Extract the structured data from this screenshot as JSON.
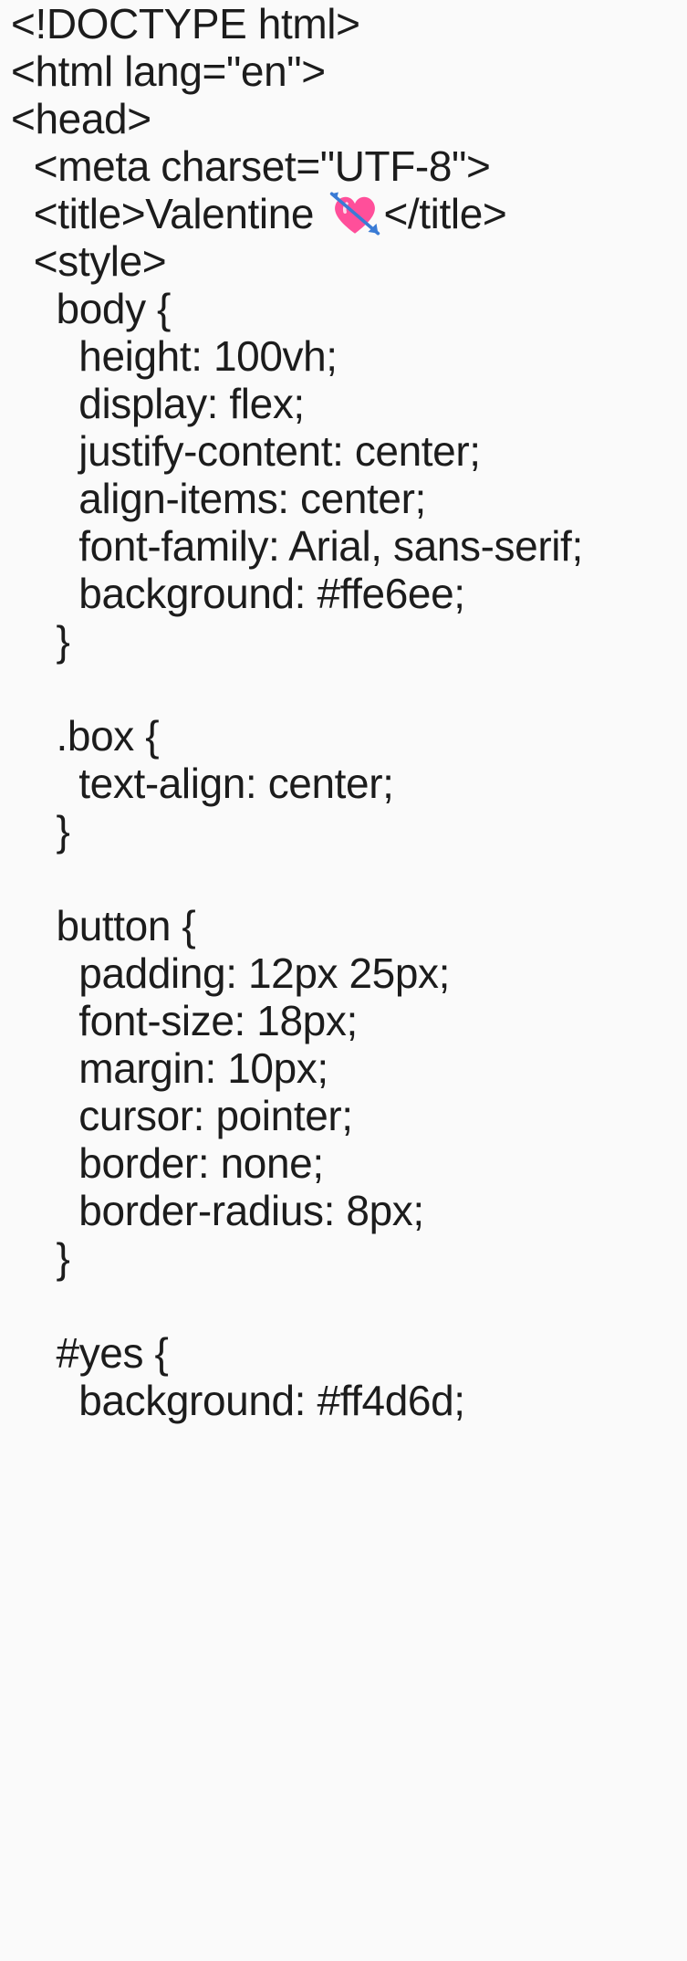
{
  "editor": {
    "lines": [
      "<!DOCTYPE html>",
      "<html lang=\"en\">",
      "<head>",
      "  <meta charset=\"UTF-8\">",
      "  <title>Valentine ",
      "  <style>",
      "    body {",
      "      height: 100vh;",
      "      display: flex;",
      "      justify-content: center;",
      "      align-items: center;",
      "      font-family: Arial, sans-serif;",
      "      background: #ffe6ee;",
      "    }",
      "",
      "    .box {",
      "      text-align: center;",
      "    }",
      "",
      "    button {",
      "      padding: 12px 25px;",
      "      font-size: 18px;",
      "      margin: 10px;",
      "      cursor: pointer;",
      "      border: none;",
      "      border-radius: 8px;",
      "    }",
      "",
      "    #yes {",
      "      background: #ff4d6d;"
    ],
    "title_line_suffix": "</title>",
    "title_emoji_icon": "heart-with-arrow-icon",
    "colors": {
      "background": "#fafafa",
      "text": "#1c1c1c",
      "heart_pink": "#ff4f9a",
      "arrow_blue": "#3a7bd5"
    }
  }
}
